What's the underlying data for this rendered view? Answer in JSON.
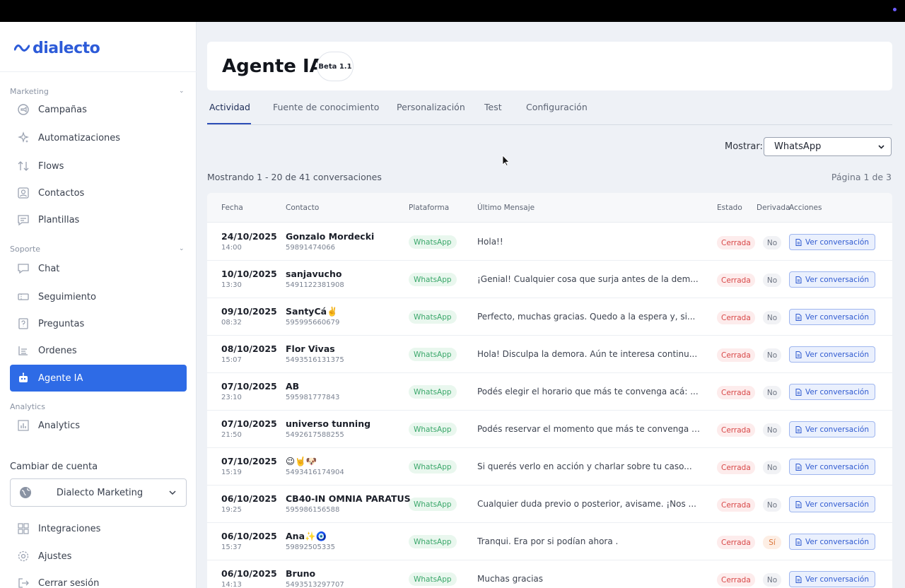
{
  "brand": {
    "name": "dialecto",
    "color": "#2d5bd8",
    "accent": "#2e6be6"
  },
  "sidebar": {
    "sections": {
      "marketing": "Marketing",
      "soporte": "Soporte",
      "analytics": "Analytics"
    },
    "items": [
      {
        "label": "Campañas",
        "icon": "megaphone-icon"
      },
      {
        "label": "Automatizaciones",
        "icon": "sparkles-icon"
      },
      {
        "label": "Flows",
        "icon": "arrows-updown-icon"
      },
      {
        "label": "Contactos",
        "icon": "contact-icon"
      },
      {
        "label": "Plantillas",
        "icon": "template-icon"
      },
      {
        "label": "Chat",
        "icon": "chat-icon"
      },
      {
        "label": "Seguimiento",
        "icon": "ticket-icon"
      },
      {
        "label": "Preguntas",
        "icon": "question-icon"
      },
      {
        "label": "Ordenes",
        "icon": "orders-icon"
      },
      {
        "label": "Agente IA",
        "icon": "robot-icon",
        "active": true
      },
      {
        "label": "Analytics",
        "icon": "chart-icon"
      },
      {
        "label": "Integraciones",
        "icon": "grid-icon"
      },
      {
        "label": "Ajustes",
        "icon": "gear-icon"
      },
      {
        "label": "Cerrar sesión",
        "icon": "logout-icon"
      }
    ],
    "account": {
      "label": "Cambiar de cuenta",
      "current": "Dialecto Marketing"
    }
  },
  "header": {
    "title": "Agente IA",
    "badge": "Beta 1.1"
  },
  "tabs": [
    "Actividad",
    "Fuente de conocimiento",
    "Personalización",
    "Test",
    "Configuración"
  ],
  "filter": {
    "label": "Mostrar:",
    "value": "WhatsApp"
  },
  "summary": {
    "count": "Mostrando 1 - 20 de 41 conversaciones",
    "page": "Página 1 de 3"
  },
  "table": {
    "headers": [
      "Fecha",
      "Contacto",
      "Plataforma",
      "Último Mensaje",
      "Estado",
      "Derivada",
      "Acciones"
    ],
    "action_label": "Ver conversación",
    "rows": [
      {
        "date": "24/10/2025",
        "time": "14:00",
        "name": "Gonzalo Mordecki",
        "phone": "59891474066",
        "platform": "WhatsApp",
        "message": "Hola!!",
        "state": "Cerrada",
        "derived": "No"
      },
      {
        "date": "10/10/2025",
        "time": "13:30",
        "name": "sanjavucho",
        "phone": "5491122381908",
        "platform": "WhatsApp",
        "message": "¡Genial! Cualquier cosa que surja antes de la dem...",
        "state": "Cerrada",
        "derived": "No"
      },
      {
        "date": "09/10/2025",
        "time": "08:32",
        "name": "SantyCá✌️",
        "phone": "595995660679",
        "platform": "WhatsApp",
        "message": "Perfecto, muchas gracias. Quedo a la espera y, si...",
        "state": "Cerrada",
        "derived": "No"
      },
      {
        "date": "08/10/2025",
        "time": "15:07",
        "name": "Flor Vivas",
        "phone": "5493516131375",
        "platform": "WhatsApp",
        "message": "Hola! Disculpa la demora. Aún te interesa continu...",
        "state": "Cerrada",
        "derived": "No"
      },
      {
        "date": "07/10/2025",
        "time": "23:10",
        "name": "AB",
        "phone": "595981777843",
        "platform": "WhatsApp",
        "message": "Podés elegir el horario que más te convenga acá: ...",
        "state": "Cerrada",
        "derived": "No"
      },
      {
        "date": "07/10/2025",
        "time": "21:50",
        "name": "universo tunning",
        "phone": "5492617588255",
        "platform": "WhatsApp",
        "message": "Podés reservar el momento que más te convenga aqu...",
        "state": "Cerrada",
        "derived": "No"
      },
      {
        "date": "07/10/2025",
        "time": "15:19",
        "name": "😉🤘🐶",
        "phone": "5493416174904",
        "platform": "WhatsApp",
        "message": "Si querés verlo en acción y charlar sobre tu caso...",
        "state": "Cerrada",
        "derived": "No"
      },
      {
        "date": "06/10/2025",
        "time": "19:25",
        "name": "CB40-IN OMNIA PARATUS",
        "phone": "595986156588",
        "platform": "WhatsApp",
        "message": "Cualquier duda previo o posterior, avisame. ¡Nos ...",
        "state": "Cerrada",
        "derived": "No"
      },
      {
        "date": "06/10/2025",
        "time": "15:37",
        "name": "Ana✨🧿",
        "phone": "59892505335",
        "platform": "WhatsApp",
        "message": "Tranqui. Era por si podían ahora .",
        "state": "Cerrada",
        "derived": "Sí"
      },
      {
        "date": "06/10/2025",
        "time": "14:13",
        "name": "Bruno",
        "phone": "5493513297707",
        "platform": "WhatsApp",
        "message": "Muchas gracias",
        "state": "Cerrada",
        "derived": "No"
      }
    ]
  }
}
